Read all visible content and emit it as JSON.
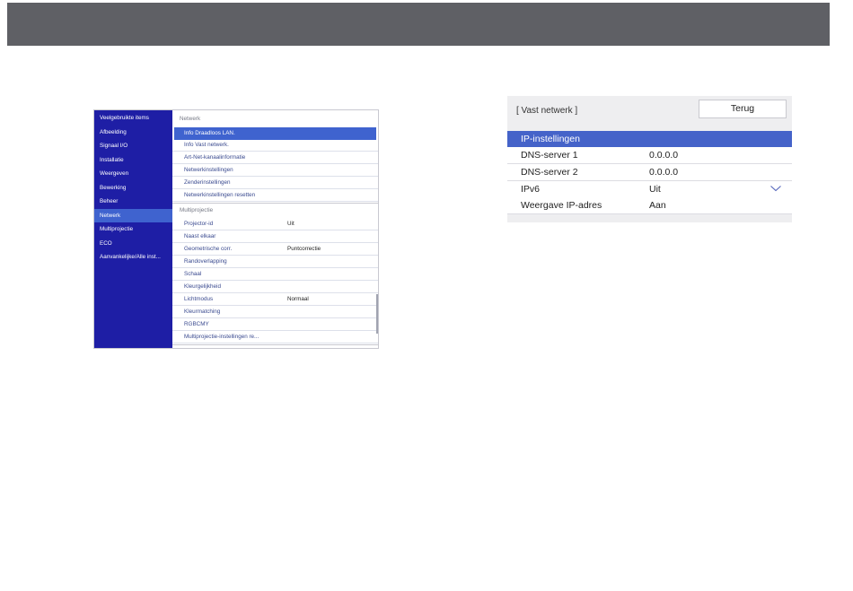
{
  "projector_menu": {
    "sidebar": {
      "items": [
        {
          "label": "Veelgebruikte items"
        },
        {
          "label": "Afbeelding"
        },
        {
          "label": "Signaal I/O"
        },
        {
          "label": "Installatie"
        },
        {
          "label": "Weergeven"
        },
        {
          "label": "Bewerking"
        },
        {
          "label": "Beheer"
        },
        {
          "label": "Netwerk"
        },
        {
          "label": "Multiprojectie"
        },
        {
          "label": "ECO"
        },
        {
          "label": "Aanvankelijke/Alle inst..."
        }
      ],
      "active_item": "Netwerk"
    },
    "section_network": {
      "heading": "Netwerk",
      "rows": [
        {
          "label": "Info Draadloos LAN."
        },
        {
          "label": "Info Vast netwerk."
        },
        {
          "label": "Art-Net-kanaalinformatie"
        },
        {
          "label": "Netwerkinstellingen"
        },
        {
          "label": "Zenderinstellingen"
        },
        {
          "label": "Netwerkinstellingen resetten"
        }
      ],
      "selected_row": "Info Draadloos LAN."
    },
    "section_multiprojection": {
      "heading": "Multiprojectie",
      "rows": [
        {
          "label": "Projector-id",
          "value": "Uit"
        },
        {
          "label": "Naast elkaar",
          "value": ""
        },
        {
          "label": "Geometrische corr.",
          "value": "Puntcorrectie"
        },
        {
          "label": "Randoverlapping",
          "value": ""
        },
        {
          "label": "Schaal",
          "value": ""
        },
        {
          "label": "Kleurgelijkheid",
          "value": ""
        },
        {
          "label": "Lichtmodus",
          "value": "Normaal"
        },
        {
          "label": "Kleurmatching",
          "value": ""
        },
        {
          "label": "RGBCMY",
          "value": ""
        },
        {
          "label": "Multiprojectie-instellingen re...",
          "value": ""
        }
      ]
    }
  },
  "wired_network_panel": {
    "title": "[ Vast netwerk ]",
    "back_button": "Terug",
    "rows": [
      {
        "label": "IP-instellingen",
        "value": ""
      },
      {
        "label": "DNS-server 1",
        "value": "0.0.0.0"
      },
      {
        "label": "DNS-server 2",
        "value": "0.0.0.0"
      },
      {
        "label": "IPv6",
        "value": "Uit"
      },
      {
        "label": "Weergave IP-adres",
        "value": "Aan"
      }
    ],
    "selected_row": "IP-instellingen",
    "dropdown_icon": "chevron-down-icon"
  },
  "colors": {
    "top_bar": "#5f6065",
    "sidebar_bg": "#1e1ea5",
    "selection": "#3f63cf",
    "row_text": "#3a4a8f"
  }
}
